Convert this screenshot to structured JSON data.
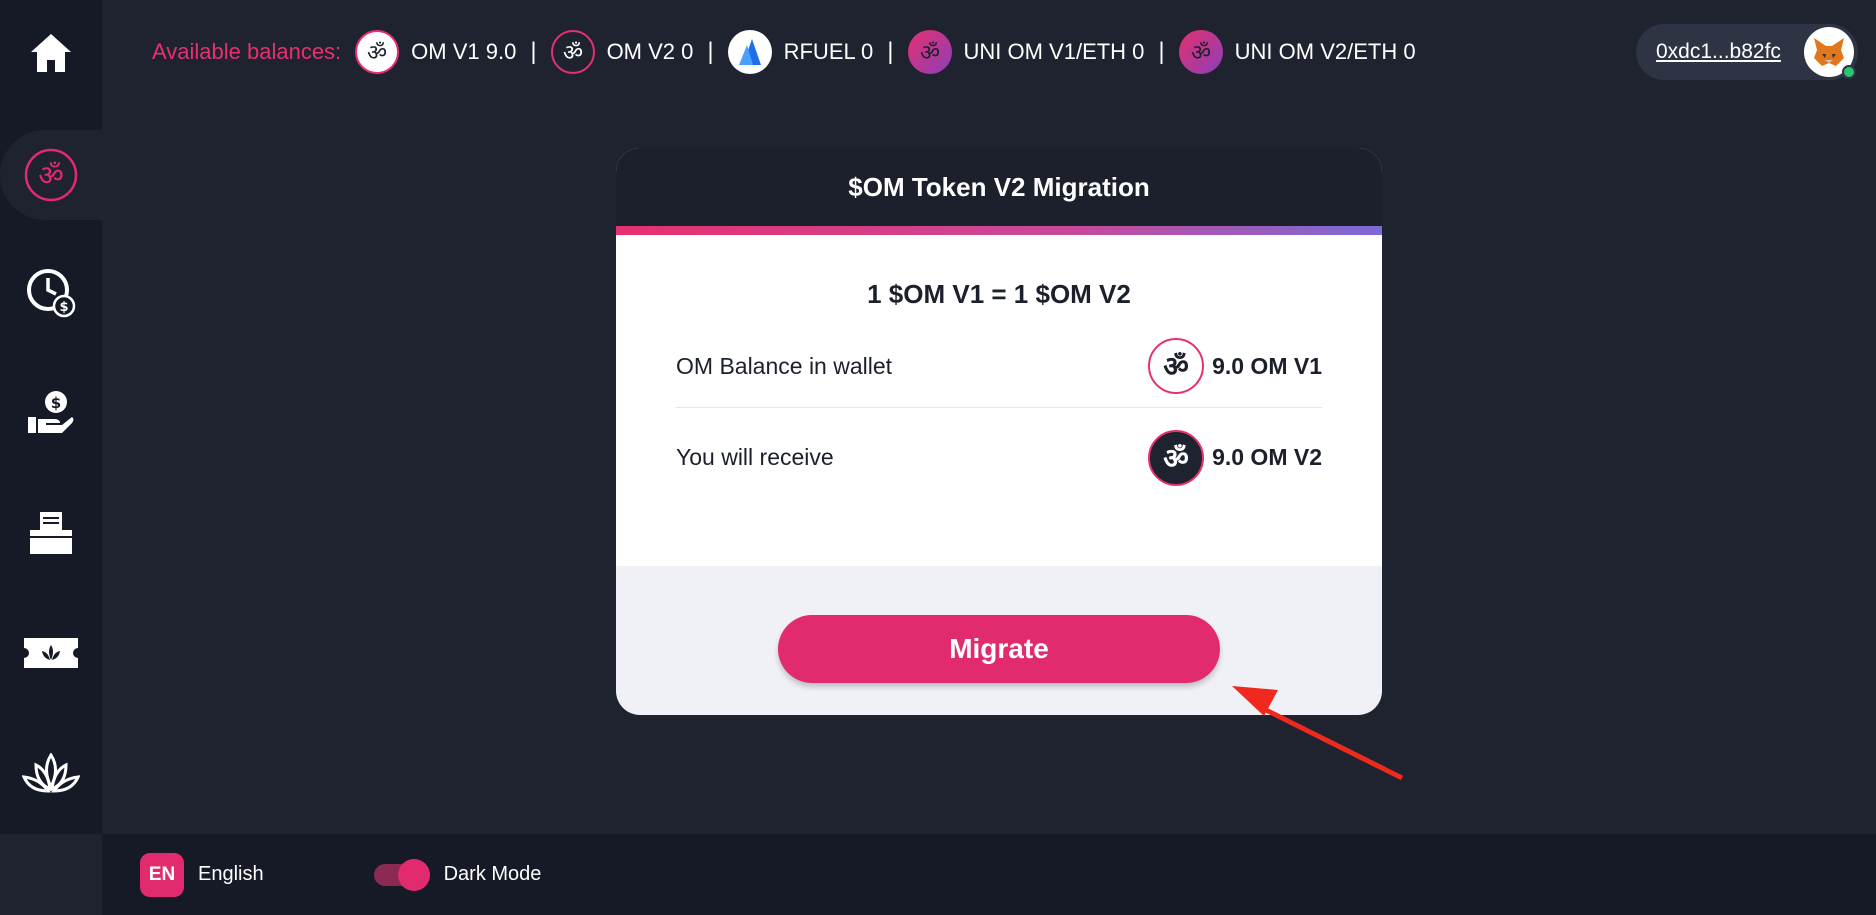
{
  "balances": {
    "label": "Available balances:",
    "items": [
      {
        "text": "OM V1 9.0",
        "icon": "om-icon"
      },
      {
        "text": "OM V2 0",
        "icon": "om-icon"
      },
      {
        "text": "RFUEL 0",
        "icon": "rfuel-icon"
      },
      {
        "text": "UNI OM V1/ETH 0",
        "icon": "om-icon"
      },
      {
        "text": "UNI OM V2/ETH 0",
        "icon": "om-icon"
      }
    ],
    "separator": "|"
  },
  "wallet": {
    "address": "0xdc1...b82fc",
    "avatar_icon": "metamask-fox-icon"
  },
  "sidebar": {
    "items": [
      {
        "name": "home",
        "icon": "home-icon"
      },
      {
        "name": "migration",
        "icon": "om-icon",
        "active": true
      },
      {
        "name": "staking",
        "icon": "clock-dollar-icon"
      },
      {
        "name": "earn",
        "icon": "hand-dollar-icon"
      },
      {
        "name": "governance",
        "icon": "ballot-box-icon"
      },
      {
        "name": "nft",
        "icon": "lotus-ticket-icon"
      },
      {
        "name": "lotus",
        "icon": "lotus-icon"
      }
    ]
  },
  "card": {
    "title": "$OM Token V2 Migration",
    "rate": "1 $OM V1 = 1 $OM V2",
    "balance_label": "OM Balance in wallet",
    "balance_value": "9.0 OM V1",
    "receive_label": "You will receive",
    "receive_value": "9.0 OM V2",
    "button": "Migrate"
  },
  "footer": {
    "lang_code": "EN",
    "lang_label": "English",
    "dark_mode_label": "Dark Mode",
    "dark_mode_on": true
  },
  "colors": {
    "accent": "#e22b6f",
    "bg": "#1f2330",
    "sidebar": "#161a26",
    "annotation": "#f0281e"
  }
}
